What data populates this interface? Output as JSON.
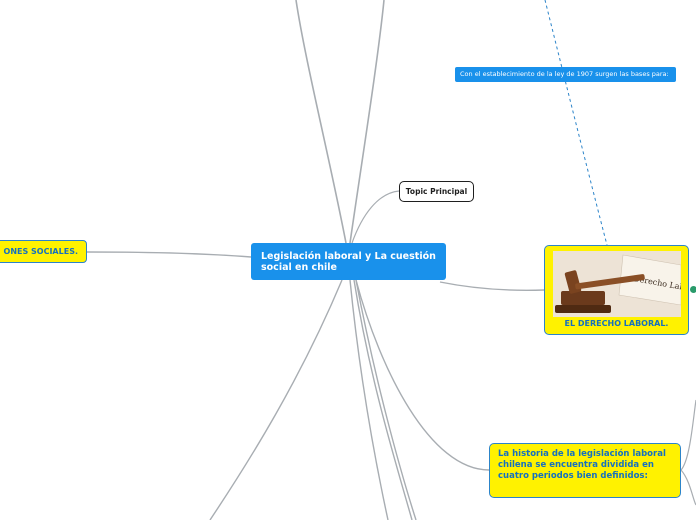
{
  "central": {
    "title": "Legislación laboral y La cuestión social en chile"
  },
  "topics": {
    "topic_principal": "Topic Principal",
    "left_node": "ONES SOCIALES.",
    "note": "Con el establecimiento de la ley de 1907 surgen las bases para:",
    "derecho": {
      "image_sign": "Derecho Laboral",
      "caption": "EL DERECHO LABORAL."
    },
    "historia": "La historia de la legislación laboral chilena se encuentra dividida en cuatro periodos bien definidos:"
  },
  "colors": {
    "central_fill": "#1991eb",
    "node_fill": "#fff200",
    "node_border": "#2c84c9",
    "node_text": "#1570bf",
    "line": "#9aa0a6",
    "dashed_line": "#2c84c9"
  }
}
